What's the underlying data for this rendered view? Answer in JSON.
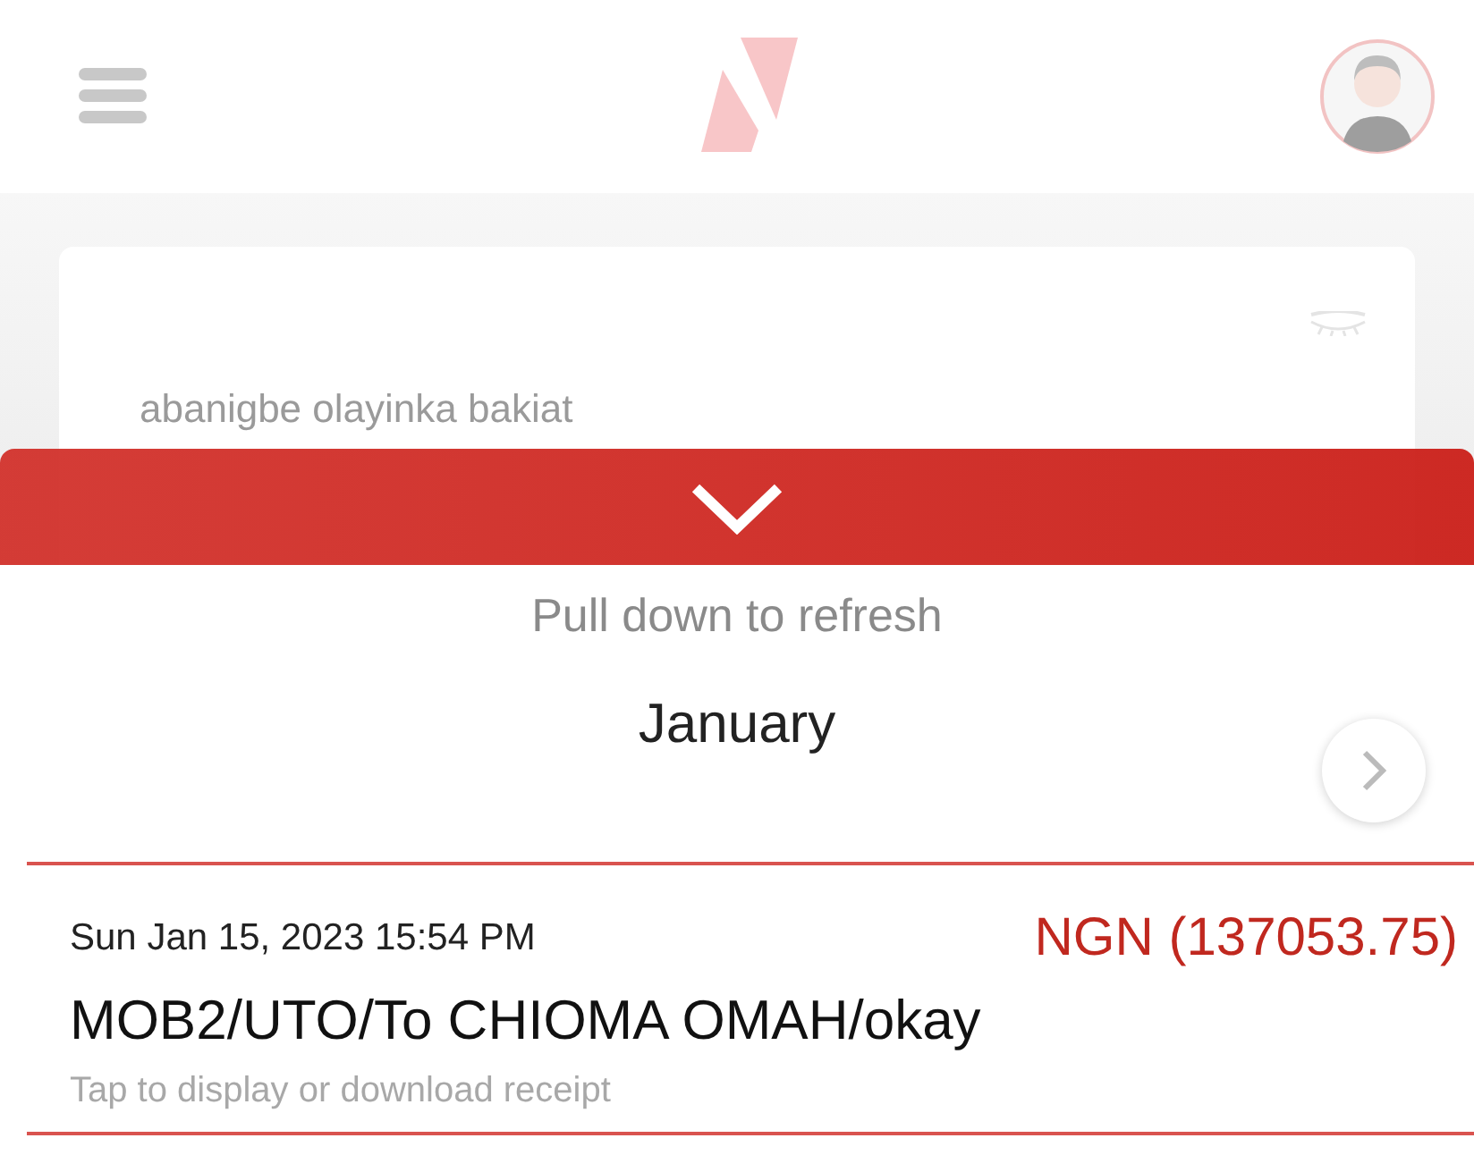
{
  "account": {
    "name": "abanigbe olayinka bakiat"
  },
  "refresh_hint": "Pull down to refresh",
  "month": "January",
  "transactions": [
    {
      "date": "Sun Jan 15, 2023 15:54 PM",
      "amount": "NGN (137053.75)",
      "description": "MOB2/UTO/To CHIOMA OMAH/okay",
      "hint": "Tap to display or download receipt",
      "kind": "debit"
    }
  ]
}
